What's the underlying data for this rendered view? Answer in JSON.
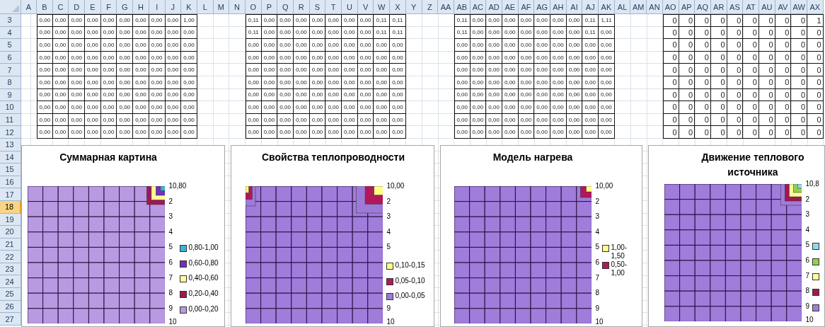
{
  "column_headers": [
    "A",
    "B",
    "C",
    "D",
    "E",
    "F",
    "G",
    "H",
    "I",
    "J",
    "K",
    "L",
    "M",
    "N",
    "O",
    "P",
    "Q",
    "R",
    "S",
    "T",
    "U",
    "V",
    "W",
    "X",
    "Y",
    "Z",
    "AA",
    "AB",
    "AC",
    "AD",
    "AE",
    "AF",
    "AG",
    "AH",
    "AI",
    "AJ",
    "AK",
    "AL",
    "AM",
    "AN",
    "AO",
    "AP",
    "AQ",
    "AR",
    "AS",
    "AT",
    "AU",
    "AV",
    "AW",
    "AX"
  ],
  "row_headers": [
    {
      "label": "3",
      "selected": false
    },
    {
      "label": "4",
      "selected": false
    },
    {
      "label": "5",
      "selected": false
    },
    {
      "label": "6",
      "selected": false
    },
    {
      "label": "7",
      "selected": false
    },
    {
      "label": "8",
      "selected": false
    },
    {
      "label": "9",
      "selected": false
    },
    {
      "label": "10",
      "selected": false
    },
    {
      "label": "11",
      "selected": false
    },
    {
      "label": "12",
      "selected": false
    },
    {
      "label": "13",
      "selected": false
    },
    {
      "label": "14",
      "selected": false
    },
    {
      "label": "15",
      "selected": false
    },
    {
      "label": "16",
      "selected": false
    },
    {
      "label": "17",
      "selected": false
    },
    {
      "label": "18",
      "selected": true
    },
    {
      "label": "19",
      "selected": false
    },
    {
      "label": "20",
      "selected": false
    },
    {
      "label": "21",
      "selected": false
    },
    {
      "label": "22",
      "selected": false
    },
    {
      "label": "23",
      "selected": false
    },
    {
      "label": "24",
      "selected": false
    },
    {
      "label": "25",
      "selected": false
    },
    {
      "label": "26",
      "selected": false
    },
    {
      "label": "27",
      "selected": false
    }
  ],
  "tables": [
    {
      "kind": "decimal",
      "rows": [
        [
          "0,00",
          "0,00",
          "0,00",
          "0,00",
          "0,00",
          "0,00",
          "0,00",
          "0,00",
          "0,00",
          "1,00"
        ],
        [
          "0,00",
          "0,00",
          "0,00",
          "0,00",
          "0,00",
          "0,00",
          "0,00",
          "0,00",
          "0,00",
          "0,00"
        ],
        [
          "0,00",
          "0,00",
          "0,00",
          "0,00",
          "0,00",
          "0,00",
          "0,00",
          "0,00",
          "0,00",
          "0,00"
        ],
        [
          "0,00",
          "0,00",
          "0,00",
          "0,00",
          "0,00",
          "0,00",
          "0,00",
          "0,00",
          "0,00",
          "0,00"
        ],
        [
          "0,00",
          "0,00",
          "0,00",
          "0,00",
          "0,00",
          "0,00",
          "0,00",
          "0,00",
          "0,00",
          "0,00"
        ],
        [
          "0,00",
          "0,00",
          "0,00",
          "0,00",
          "0,00",
          "0,00",
          "0,00",
          "0,00",
          "0,00",
          "0,00"
        ],
        [
          "0,00",
          "0,00",
          "0,00",
          "0,00",
          "0,00",
          "0,00",
          "0,00",
          "0,00",
          "0,00",
          "0,00"
        ],
        [
          "0,00",
          "0,00",
          "0,00",
          "0,00",
          "0,00",
          "0,00",
          "0,00",
          "0,00",
          "0,00",
          "0,00"
        ],
        [
          "0,00",
          "0,00",
          "0,00",
          "0,00",
          "0,00",
          "0,00",
          "0,00",
          "0,00",
          "0,00",
          "0,00"
        ],
        [
          "0,00",
          "0,00",
          "0,00",
          "0,00",
          "0,00",
          "0,00",
          "0,00",
          "0,00",
          "0,00",
          "0,00"
        ]
      ]
    },
    {
      "kind": "decimal",
      "rows": [
        [
          "0,11",
          "0,00",
          "0,00",
          "0,00",
          "0,00",
          "0,00",
          "0,00",
          "0,00",
          "0,11",
          "0,11"
        ],
        [
          "0,11",
          "0,00",
          "0,00",
          "0,00",
          "0,00",
          "0,00",
          "0,00",
          "0,00",
          "0,11",
          "0,11"
        ],
        [
          "0,00",
          "0,00",
          "0,00",
          "0,00",
          "0,00",
          "0,00",
          "0,00",
          "0,00",
          "0,00",
          "0,00"
        ],
        [
          "0,00",
          "0,00",
          "0,00",
          "0,00",
          "0,00",
          "0,00",
          "0,00",
          "0,00",
          "0,00",
          "0,00"
        ],
        [
          "0,00",
          "0,00",
          "0,00",
          "0,00",
          "0,00",
          "0,00",
          "0,00",
          "0,00",
          "0,00",
          "0,00"
        ],
        [
          "0,00",
          "0,00",
          "0,00",
          "0,00",
          "0,00",
          "0,00",
          "0,00",
          "0,00",
          "0,00",
          "0,00"
        ],
        [
          "0,00",
          "0,00",
          "0,00",
          "0,00",
          "0,00",
          "0,00",
          "0,00",
          "0,00",
          "0,00",
          "0,00"
        ],
        [
          "0,00",
          "0,00",
          "0,00",
          "0,00",
          "0,00",
          "0,00",
          "0,00",
          "0,00",
          "0,00",
          "0,00"
        ],
        [
          "0,00",
          "0,00",
          "0,00",
          "0,00",
          "0,00",
          "0,00",
          "0,00",
          "0,00",
          "0,00",
          "0,00"
        ],
        [
          "0,00",
          "0,00",
          "0,00",
          "0,00",
          "0,00",
          "0,00",
          "0,00",
          "0,00",
          "0,00",
          "0,00"
        ]
      ]
    },
    {
      "kind": "decimal",
      "rows": [
        [
          "0,11",
          "0,00",
          "0,00",
          "0,00",
          "0,00",
          "0,00",
          "0,00",
          "0,00",
          "0,11",
          "1,11"
        ],
        [
          "0,11",
          "0,00",
          "0,00",
          "0,00",
          "0,00",
          "0,00",
          "0,00",
          "0,00",
          "0,11",
          "0,00"
        ],
        [
          "0,00",
          "0,00",
          "0,00",
          "0,00",
          "0,00",
          "0,00",
          "0,00",
          "0,00",
          "0,00",
          "0,00"
        ],
        [
          "0,00",
          "0,00",
          "0,00",
          "0,00",
          "0,00",
          "0,00",
          "0,00",
          "0,00",
          "0,00",
          "0,00"
        ],
        [
          "0,00",
          "0,00",
          "0,00",
          "0,00",
          "0,00",
          "0,00",
          "0,00",
          "0,00",
          "0,00",
          "0,00"
        ],
        [
          "0,00",
          "0,00",
          "0,00",
          "0,00",
          "0,00",
          "0,00",
          "0,00",
          "0,00",
          "0,00",
          "0,00"
        ],
        [
          "0,00",
          "0,00",
          "0,00",
          "0,00",
          "0,00",
          "0,00",
          "0,00",
          "0,00",
          "0,00",
          "0,00"
        ],
        [
          "0,00",
          "0,00",
          "0,00",
          "0,00",
          "0,00",
          "0,00",
          "0,00",
          "0,00",
          "0,00",
          "0,00"
        ],
        [
          "0,00",
          "0,00",
          "0,00",
          "0,00",
          "0,00",
          "0,00",
          "0,00",
          "0,00",
          "0,00",
          "0,00"
        ],
        [
          "0,00",
          "0,00",
          "0,00",
          "0,00",
          "0,00",
          "0,00",
          "0,00",
          "0,00",
          "0,00",
          "0,00"
        ]
      ]
    },
    {
      "kind": "integer",
      "rows": [
        [
          "0",
          "0",
          "0",
          "0",
          "0",
          "0",
          "0",
          "0",
          "0",
          "1"
        ],
        [
          "0",
          "0",
          "0",
          "0",
          "0",
          "0",
          "0",
          "0",
          "0",
          "0"
        ],
        [
          "0",
          "0",
          "0",
          "0",
          "0",
          "0",
          "0",
          "0",
          "0",
          "0"
        ],
        [
          "0",
          "0",
          "0",
          "0",
          "0",
          "0",
          "0",
          "0",
          "0",
          "0"
        ],
        [
          "0",
          "0",
          "0",
          "0",
          "0",
          "0",
          "0",
          "0",
          "0",
          "0"
        ],
        [
          "0",
          "0",
          "0",
          "0",
          "0",
          "0",
          "0",
          "0",
          "0",
          "0"
        ],
        [
          "0",
          "0",
          "0",
          "0",
          "0",
          "0",
          "0",
          "0",
          "0",
          "0"
        ],
        [
          "0",
          "0",
          "0",
          "0",
          "0",
          "0",
          "0",
          "0",
          "0",
          "0"
        ],
        [
          "0",
          "0",
          "0",
          "0",
          "0",
          "0",
          "0",
          "0",
          "0",
          "0"
        ],
        [
          "0",
          "0",
          "0",
          "0",
          "0",
          "0",
          "0",
          "0",
          "0",
          "0"
        ]
      ]
    }
  ],
  "charts": [
    {
      "title": "Суммарная картина",
      "axis": [
        {
          "kind": "tick",
          "label": "10,80"
        },
        {
          "kind": "tick",
          "label": "2"
        },
        {
          "kind": "tick",
          "label": "3"
        },
        {
          "kind": "tick",
          "label": "4"
        },
        {
          "kind": "tick",
          "label": "5"
        },
        {
          "kind": "tick",
          "label": "6"
        },
        {
          "kind": "tick",
          "label": "7"
        },
        {
          "kind": "tick",
          "label": "8"
        },
        {
          "kind": "tick",
          "label": "9"
        },
        {
          "kind": "tick",
          "label": "10"
        }
      ],
      "legend": [
        {
          "label": "0,80-1,00",
          "color": "#3bb3d6"
        },
        {
          "label": "0,60-0,80",
          "color": "#7030c0"
        },
        {
          "label": "0,40-0,60",
          "color": "#ffff99"
        },
        {
          "label": "0,20-0,40",
          "color": "#a01850"
        },
        {
          "label": "0,00-0,20",
          "color": "#b89ae3"
        }
      ]
    },
    {
      "title": "Свойства теплопроводности",
      "axis": [
        {
          "kind": "tick",
          "label": "10,00"
        },
        {
          "kind": "tick",
          "label": "2"
        },
        {
          "kind": "tick",
          "label": "3"
        },
        {
          "kind": "tick",
          "label": "4"
        },
        {
          "kind": "tick",
          "label": "5"
        },
        {
          "kind": "legend",
          "label": "0,10-0,15",
          "color": "#ffff88"
        },
        {
          "kind": "legend",
          "label": "0,05-0,10",
          "color": "#b0185a"
        },
        {
          "kind": "legend",
          "label": "0,00-0,05",
          "color": "#9e7ad8"
        },
        {
          "kind": "tick",
          "label": "9"
        },
        {
          "kind": "tick",
          "label": "10"
        }
      ]
    },
    {
      "title": "Модель нагрева",
      "axis": [
        {
          "kind": "tick",
          "label": "10,00"
        },
        {
          "kind": "tick",
          "label": "2"
        },
        {
          "kind": "tick",
          "label": "3"
        },
        {
          "kind": "tick",
          "label": "4"
        },
        {
          "kind": "tick",
          "label": "5"
        },
        {
          "kind": "tick",
          "label": "6"
        },
        {
          "kind": "tick",
          "label": "7"
        },
        {
          "kind": "tick",
          "label": "8"
        },
        {
          "kind": "tick",
          "label": "9"
        },
        {
          "kind": "tick",
          "label": "10"
        }
      ],
      "legend": [
        {
          "label": "1,00-1,50",
          "color": "#ffff88"
        },
        {
          "label": "0,50-1,00",
          "color": "#b0185a"
        }
      ]
    },
    {
      "title": "Движение теплового источника",
      "axis": [
        {
          "kind": "tick",
          "label": "10,8"
        },
        {
          "kind": "tick",
          "label": "2"
        },
        {
          "kind": "tick",
          "label": "3"
        },
        {
          "kind": "tick",
          "label": "4"
        },
        {
          "kind": "tick",
          "label": "5"
        },
        {
          "kind": "tick",
          "label": "6"
        },
        {
          "kind": "tick",
          "label": "7"
        },
        {
          "kind": "tick",
          "label": "8"
        },
        {
          "kind": "tick",
          "label": "9"
        },
        {
          "kind": "tick",
          "label": "10"
        }
      ],
      "legend": [
        {
          "color": "#8fd8f0"
        },
        {
          "color": "#92d050"
        },
        {
          "color": "#ffff99"
        },
        {
          "color": "#a01850"
        },
        {
          "color": "#a07cdb"
        }
      ]
    }
  ]
}
